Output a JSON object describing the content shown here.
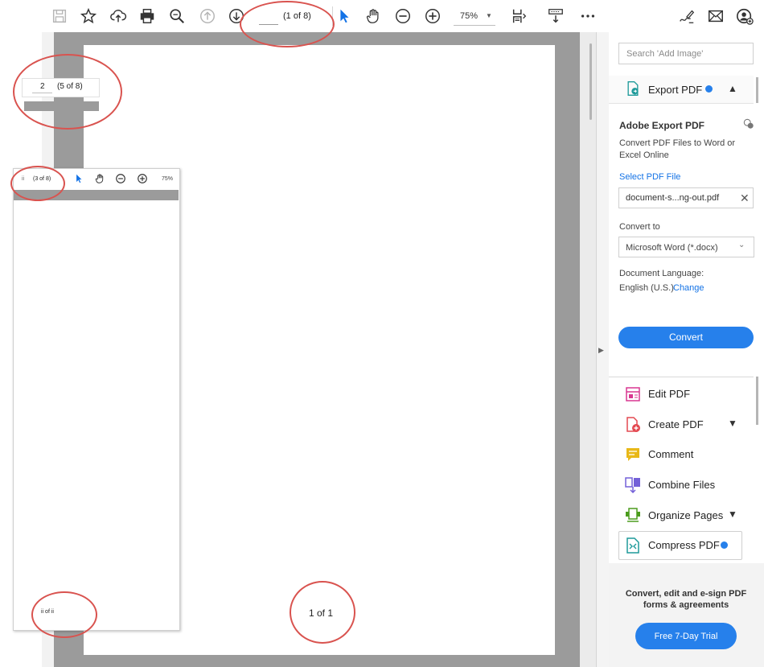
{
  "toolbar": {
    "page_input": "",
    "page_count": "(1 of 8)",
    "zoom": "75%",
    "icons": [
      "save-icon",
      "star-icon",
      "upload-cloud-icon",
      "print-icon",
      "zoom-search-icon",
      "previous-page-icon",
      "next-page-icon",
      "pointer-icon",
      "hand-icon",
      "zoom-out-icon",
      "zoom-in-icon",
      "page-display-icon",
      "scroll-mode-icon",
      "more-icon",
      "sign-icon",
      "email-icon",
      "account-icon"
    ]
  },
  "document": {
    "page_label": "1 of 1"
  },
  "inset_small": {
    "page_input": "2",
    "page_count": "(5 of 8)"
  },
  "inset_window": {
    "page_input": "ii",
    "page_count": "(3 of 8)",
    "zoom": "75%",
    "footer": "ii of ii"
  },
  "right_pane": {
    "search_placeholder": "Search 'Add Image'",
    "export": {
      "label": "Export PDF",
      "title": "Adobe Export PDF",
      "description": "Convert PDF Files to Word or Excel Online",
      "select_link": "Select PDF File",
      "file_name": "document-s...ng-out.pdf",
      "convert_to_label": "Convert to",
      "convert_to_value": "Microsoft Word (*.docx)",
      "language_label": "Document Language:",
      "language_value": "English (U.S.)",
      "change_link": "Change",
      "convert_button": "Convert"
    },
    "tools": [
      {
        "label": "Edit PDF",
        "icon": "edit-pdf-icon",
        "color": "#d83790"
      },
      {
        "label": "Create PDF",
        "icon": "create-pdf-icon",
        "color": "#e34850"
      },
      {
        "label": "Comment",
        "icon": "comment-icon",
        "color": "#e8b818"
      },
      {
        "label": "Combine Files",
        "icon": "combine-files-icon",
        "color": "#7461d8"
      },
      {
        "label": "Organize Pages",
        "icon": "organize-pages-icon",
        "color": "#4b9c1d"
      },
      {
        "label": "Compress PDF",
        "icon": "compress-pdf-icon",
        "color": "#1e9a9a"
      }
    ],
    "footer_text": "Convert, edit and e-sign PDF forms & agreements",
    "trial_button": "Free 7-Day Trial"
  },
  "colors": {
    "accent": "#2680eb",
    "annotation_ring": "#d9534f",
    "doc_background": "#9b9b9b"
  }
}
